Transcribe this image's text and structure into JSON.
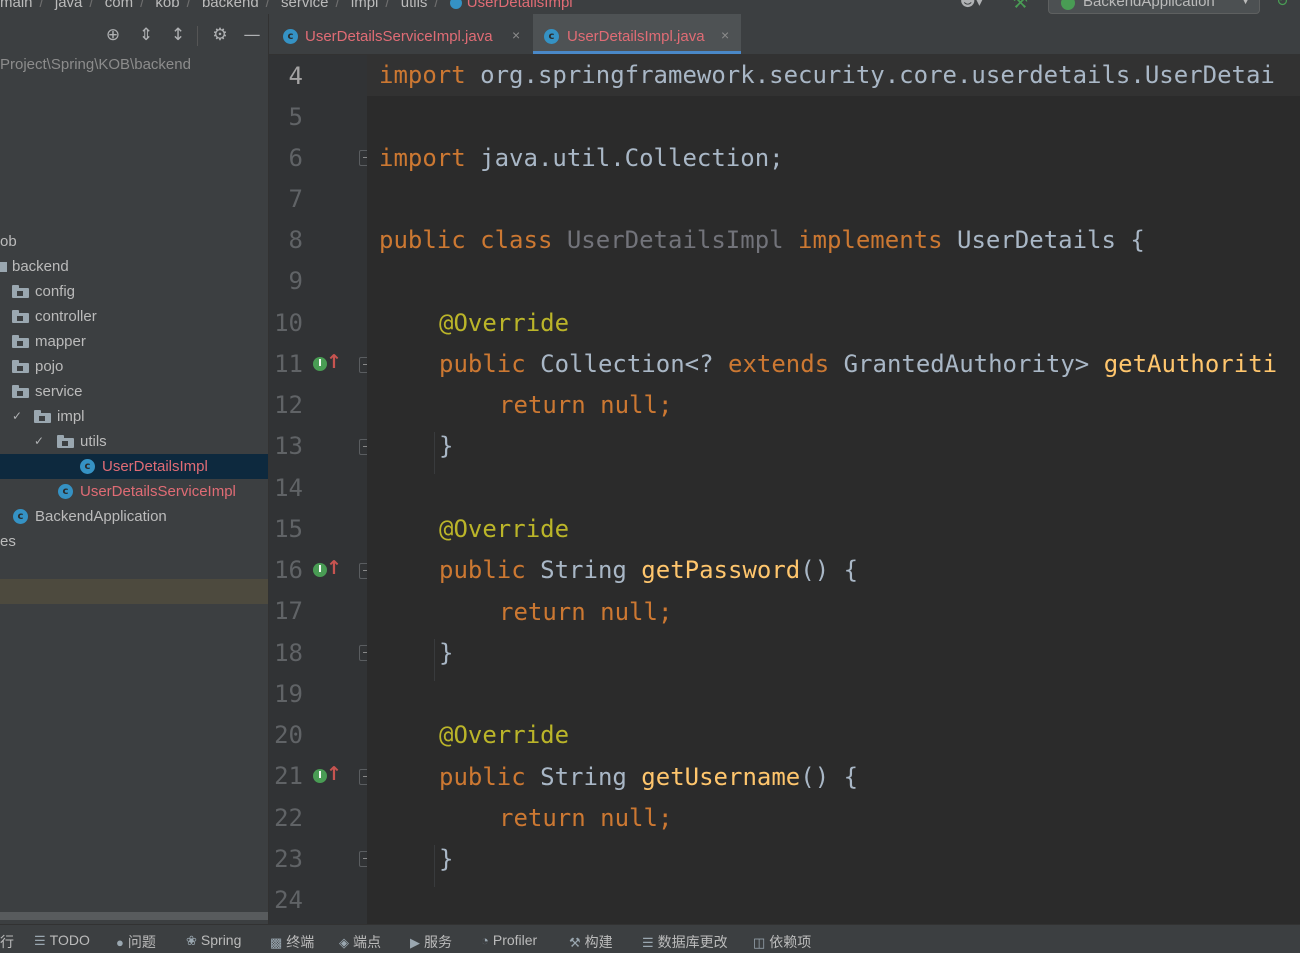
{
  "breadcrumb": {
    "items": [
      "main",
      "java",
      "com",
      "kob",
      "backend",
      "service",
      "impl",
      "utils"
    ],
    "current": "UserDetailsImpl",
    "run_config": "BackendApplication"
  },
  "project": {
    "path": "Project\\Spring\\KOB\\backend",
    "tree": [
      {
        "label": "ob",
        "type": "text"
      },
      {
        "label": "backend",
        "type": "package"
      },
      {
        "label": "config",
        "type": "folder"
      },
      {
        "label": "controller",
        "type": "folder"
      },
      {
        "label": "mapper",
        "type": "folder"
      },
      {
        "label": "pojo",
        "type": "folder"
      },
      {
        "label": "service",
        "type": "folder"
      },
      {
        "label": "impl",
        "type": "folder"
      },
      {
        "label": "utils",
        "type": "folder"
      },
      {
        "label": "UserDetailsImpl",
        "type": "class"
      },
      {
        "label": "UserDetailsServiceImpl",
        "type": "class"
      },
      {
        "label": "BackendApplication",
        "type": "app"
      },
      {
        "label": "es",
        "type": "text"
      }
    ]
  },
  "tabs": [
    {
      "label": "UserDetailsServiceImpl.java",
      "active": false
    },
    {
      "label": "UserDetailsImpl.java",
      "active": true
    }
  ],
  "editor": {
    "line_numbers": [
      "4",
      "5",
      "6",
      "7",
      "8",
      "9",
      "10",
      "11",
      "12",
      "13",
      "14",
      "15",
      "16",
      "17",
      "18",
      "19",
      "20",
      "21",
      "22",
      "23",
      "24"
    ],
    "lines": {
      "l4": {
        "kw": "import",
        "rest": " org.springframework.security.core.userdetails.UserDetai"
      },
      "l6": {
        "kw": "import",
        "rest": " java.util.Collection;"
      },
      "l8": {
        "kw1": "public",
        "kw2": " class ",
        "name": "UserDetailsImpl",
        "kw3": " implements",
        "rest": " UserDetails {"
      },
      "l10": {
        "ann": "@Override"
      },
      "l11": {
        "kw1": "public",
        "mid": " Collection<? ",
        "kw2": "extends",
        "rest": " GrantedAuthority> ",
        "fn": "getAuthoriti"
      },
      "l12": {
        "kw": "return null",
        "rest": ";"
      },
      "l13": {
        "rest": "}"
      },
      "l15": {
        "ann": "@Override"
      },
      "l16": {
        "kw1": "public",
        "mid": " String ",
        "fn": "getPassword",
        "rest": "() {"
      },
      "l17": {
        "kw": "return null",
        "rest": ";"
      },
      "l18": {
        "rest": "}"
      },
      "l20": {
        "ann": "@Override"
      },
      "l21": {
        "kw1": "public",
        "mid": " String ",
        "fn": "getUsername",
        "rest": "() {"
      },
      "l22": {
        "kw": "return null",
        "rest": ";"
      },
      "l23": {
        "rest": "}"
      }
    }
  },
  "bottombar": {
    "items": [
      "行",
      "TODO",
      "问题",
      "Spring",
      "终端",
      "端点",
      "服务",
      "Profiler",
      "构建",
      "数据库更改",
      "依赖项"
    ]
  },
  "colors": {
    "keyword": "#cc7832",
    "annotation": "#bbb529",
    "method": "#ffc66d",
    "modified_file": "#e06c75",
    "class_icon": "#3592c4",
    "tab_underline": "#4a88c7"
  }
}
